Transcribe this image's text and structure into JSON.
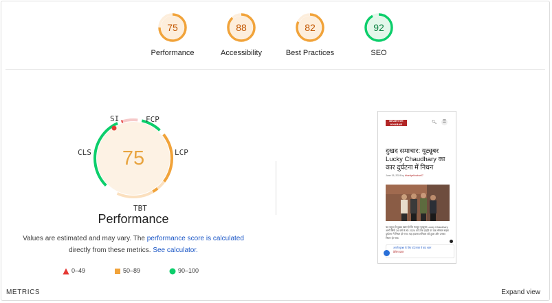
{
  "categories": [
    {
      "score": "75",
      "label": "Performance",
      "fraction": 0.75,
      "color": "#f1a33a",
      "text_color": "#c25600",
      "track": "#fdeedc"
    },
    {
      "score": "88",
      "label": "Accessibility",
      "fraction": 0.88,
      "color": "#f1a33a",
      "text_color": "#c25600",
      "track": "#fdeedc"
    },
    {
      "score": "82",
      "label": "Best Practices",
      "fraction": 0.82,
      "color": "#f1a33a",
      "text_color": "#c25600",
      "track": "#fdeedc"
    },
    {
      "score": "92",
      "label": "SEO",
      "fraction": 0.92,
      "color": "#0cce6b",
      "text_color": "#08803e",
      "track": "#e3f7ea"
    }
  ],
  "performance": {
    "score": "75",
    "title": "Performance",
    "metrics": [
      "SI",
      "FCP",
      "LCP",
      "TBT",
      "CLS"
    ],
    "desc_part1": "Values are estimated and may vary. The ",
    "desc_link1": "performance score is calculated",
    "desc_part2": "directly from these metrics. ",
    "desc_link2": "See calculator.",
    "legend": [
      {
        "range": "0–49",
        "shape": "triangle",
        "color": "#e53935"
      },
      {
        "range": "50–89",
        "shape": "square",
        "color": "#f1a33a"
      },
      {
        "range": "90–100",
        "shape": "circle",
        "color": "#0cce6b"
      }
    ]
  },
  "screenshot": {
    "logo_line1": "BHARTIYE",
    "logo_line2": "KHABAR",
    "headline": "दुखद समाचार: यूट्यूबर Lucky Chaudhary का कार दुर्घटना में निधन",
    "date": "June 15, 2024 by ",
    "author": "bhartiyekhabar07",
    "body": "यह बहुत ही दुखद खबर है कि मशहूर यूट्यूबर Lucky Chaudhary अभी सिर्फ 26 वर्ष के थे। 2024 को टोंक हाईवे पर एक भीषण सड़क दुर्घटना में निधन हो गया। यह हादसा शनिवार को हुआ और उनका निधन हो गया।",
    "comment_line1": "अपनी सुरक्षा के लिए पढ़ें सफर में बाद ध्यान",
    "comment_line2": "ब्रेकिंग ख़बर"
  },
  "footer": {
    "metrics_heading": "METRICS",
    "expand_label": "Expand view"
  }
}
